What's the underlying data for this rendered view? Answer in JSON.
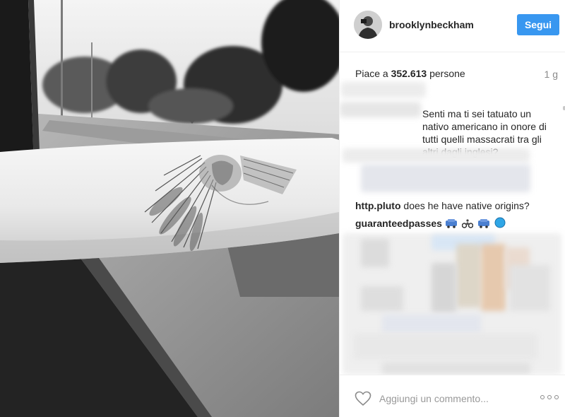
{
  "post": {
    "username": "brooklynbeckham",
    "follow_label": "Segui",
    "likes_label": "Piace a",
    "likes_count": "352.613",
    "likes_suffix": "persone",
    "timestamp": "1 g"
  },
  "comments": {
    "first": {
      "visible_text": "Senti ma ti sei tatuato un nativo americano in onore di tutti quelli massacrati tra gli altri dagli inglesi?"
    },
    "second": {
      "user": "http.pluto",
      "text": "does he have native origins?"
    },
    "third": {
      "user": "guaranteedpasses",
      "emoji": [
        "car-emoji",
        "motorbike-emoji",
        "car-emoji",
        "blue-circle-emoji"
      ]
    }
  },
  "footer": {
    "comment_placeholder": "Aggiungi un commento...",
    "like_icon": "heart-outline-icon",
    "more_icon": "more-options-icon"
  },
  "colors": {
    "accent": "#3897f0",
    "text": "#262626",
    "muted": "#999999",
    "divider": "#efefef"
  }
}
